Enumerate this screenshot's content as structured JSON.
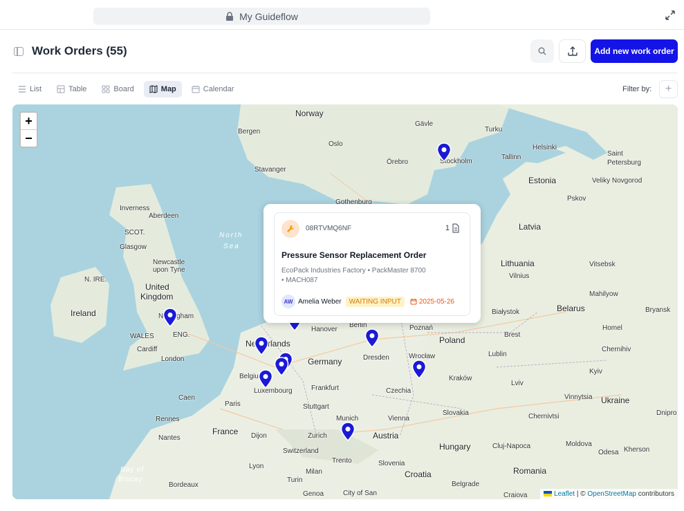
{
  "browser": {
    "title": "My Guideflow"
  },
  "header": {
    "title": "Work Orders (55)",
    "add_button": "Add new work order"
  },
  "views": {
    "tabs": [
      {
        "label": "List",
        "icon": "list-icon"
      },
      {
        "label": "Table",
        "icon": "table-icon"
      },
      {
        "label": "Board",
        "icon": "board-icon"
      },
      {
        "label": "Map",
        "icon": "map-icon",
        "active": true
      },
      {
        "label": "Calendar",
        "icon": "calendar-icon"
      }
    ],
    "filter_label": "Filter by:"
  },
  "map": {
    "zoom_in": "+",
    "zoom_out": "−",
    "labels": {
      "norway": "Norway",
      "bergen": "Bergen",
      "oslo": "Oslo",
      "stavanger": "Stavanger",
      "gavle": "Gävle",
      "turku": "Turku",
      "helsinki": "Helsinki",
      "saint": "Saint",
      "petersburg": "Petersburg",
      "stockholm": "Stockholm",
      "orebro": "Örebro",
      "tallinn": "Tallinn",
      "estonia": "Estonia",
      "novgorod": "Veliky Novgorod",
      "pskov": "Pskov",
      "gothenburg": "Gothenburg",
      "inverness": "Inverness",
      "aberdeen": "Aberdeen",
      "scot": "SCOT.",
      "glasgow": "Glasgow",
      "newcastle": "Newcastle",
      "upontyne": "upon Tyne",
      "nire": "N. IRE.",
      "uk1": "United",
      "uk2": "Kingdom",
      "ireland": "Ireland",
      "northsea1": "North",
      "northsea2": "Sea",
      "wales": "WALES",
      "eng": "ENG.",
      "cardiff": "Cardiff",
      "london": "London",
      "nottingham": "Nottingham",
      "latvia": "Latvia",
      "lithuania": "Lithuania",
      "vilnius": "Vilnius",
      "vitsebsk": "Vitsebsk",
      "mahilyow": "Mahilyow",
      "belarus": "Belarus",
      "bryansk": "Bryansk",
      "bialystok": "Białystok",
      "homel": "Homel",
      "brest": "Brest",
      "chernihiv": "Chernihiv",
      "netherlands": "Netherlands",
      "hanover": "Hanover",
      "berlin": "Berlin",
      "poznan": "Poznań",
      "poland": "Poland",
      "germany": "Germany",
      "dresden": "Dresden",
      "wroclaw": "Wrocław",
      "lublin": "Lublin",
      "belgium": "Belgium",
      "luxembourg": "Luxembourg",
      "frankfurt": "Frankfurt",
      "krakow": "Kraków",
      "czechia": "Czechia",
      "lviv": "Lviv",
      "kyiv": "Kyiv",
      "caen": "Caen",
      "paris": "Paris",
      "stuttgart": "Stuttgart",
      "vinnytsia": "Vinnytsia",
      "ukraine": "Ukraine",
      "slovakia": "Slovakia",
      "vienna": "Vienna",
      "munich": "Munich",
      "rennes": "Rennes",
      "chernivtsi": "Chernivtsi",
      "dnipro": "Dnipro",
      "france": "France",
      "nantes": "Nantes",
      "dijon": "Dijon",
      "zurich": "Zurich",
      "austria": "Austria",
      "hungary": "Hungary",
      "clujnapoca": "Cluj-Napoca",
      "moldova": "Moldova",
      "odesa": "Odesa",
      "kherson": "Kherson",
      "switzerland": "Switzerland",
      "trento": "Trento",
      "slovenia": "Slovenia",
      "lyon": "Lyon",
      "milan": "Milan",
      "turin": "Turin",
      "croatia": "Croatia",
      "romania": "Romania",
      "bayof": "Bay of",
      "biscay": "Biscay",
      "bordeaux": "Bordeaux",
      "genoa": "Genoa",
      "cityofsan": "City of San",
      "belgrade": "Belgrade",
      "craiova": "Craiova"
    },
    "attribution": {
      "leaflet": "Leaflet",
      "sep": " | © ",
      "osm": "OpenStreetMap",
      "suffix": " contributors"
    }
  },
  "popup": {
    "code": "08RTVMQ6NF",
    "count": "1",
    "title": "Pressure Sensor Replacement Order",
    "factory": "EcoPack Industries Factory",
    "machine": "PackMaster 8700",
    "machine_id": "MACH087",
    "avatar_initials": "AW",
    "assignee": "Amelia Weber",
    "status": "WAITING INPUT",
    "date": "2025-05-26"
  },
  "colors": {
    "accent": "#1414e6",
    "pin": "#1a1ad6",
    "status_bg": "#fef3c7",
    "status_text": "#d97706",
    "date": "#ea580c"
  }
}
